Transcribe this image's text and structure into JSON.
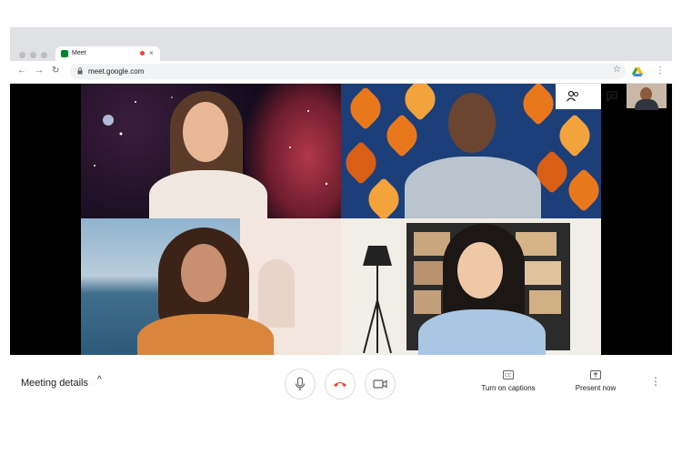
{
  "browser": {
    "tab_title": "Meet",
    "url": "meet.google.com",
    "close": "×",
    "back": "←",
    "forward": "→",
    "reload": "↻",
    "star": "☆",
    "menu": "⋮"
  },
  "top_controls": {
    "people_icon": "people-icon",
    "chat_icon": "chat-icon"
  },
  "bottom_bar": {
    "meeting_details": "Meeting details",
    "captions_label": "Turn on captions",
    "present_label": "Present now",
    "chevron": "^"
  },
  "colors": {
    "end_call": "#ea4335",
    "accent": "#1a73e8"
  }
}
